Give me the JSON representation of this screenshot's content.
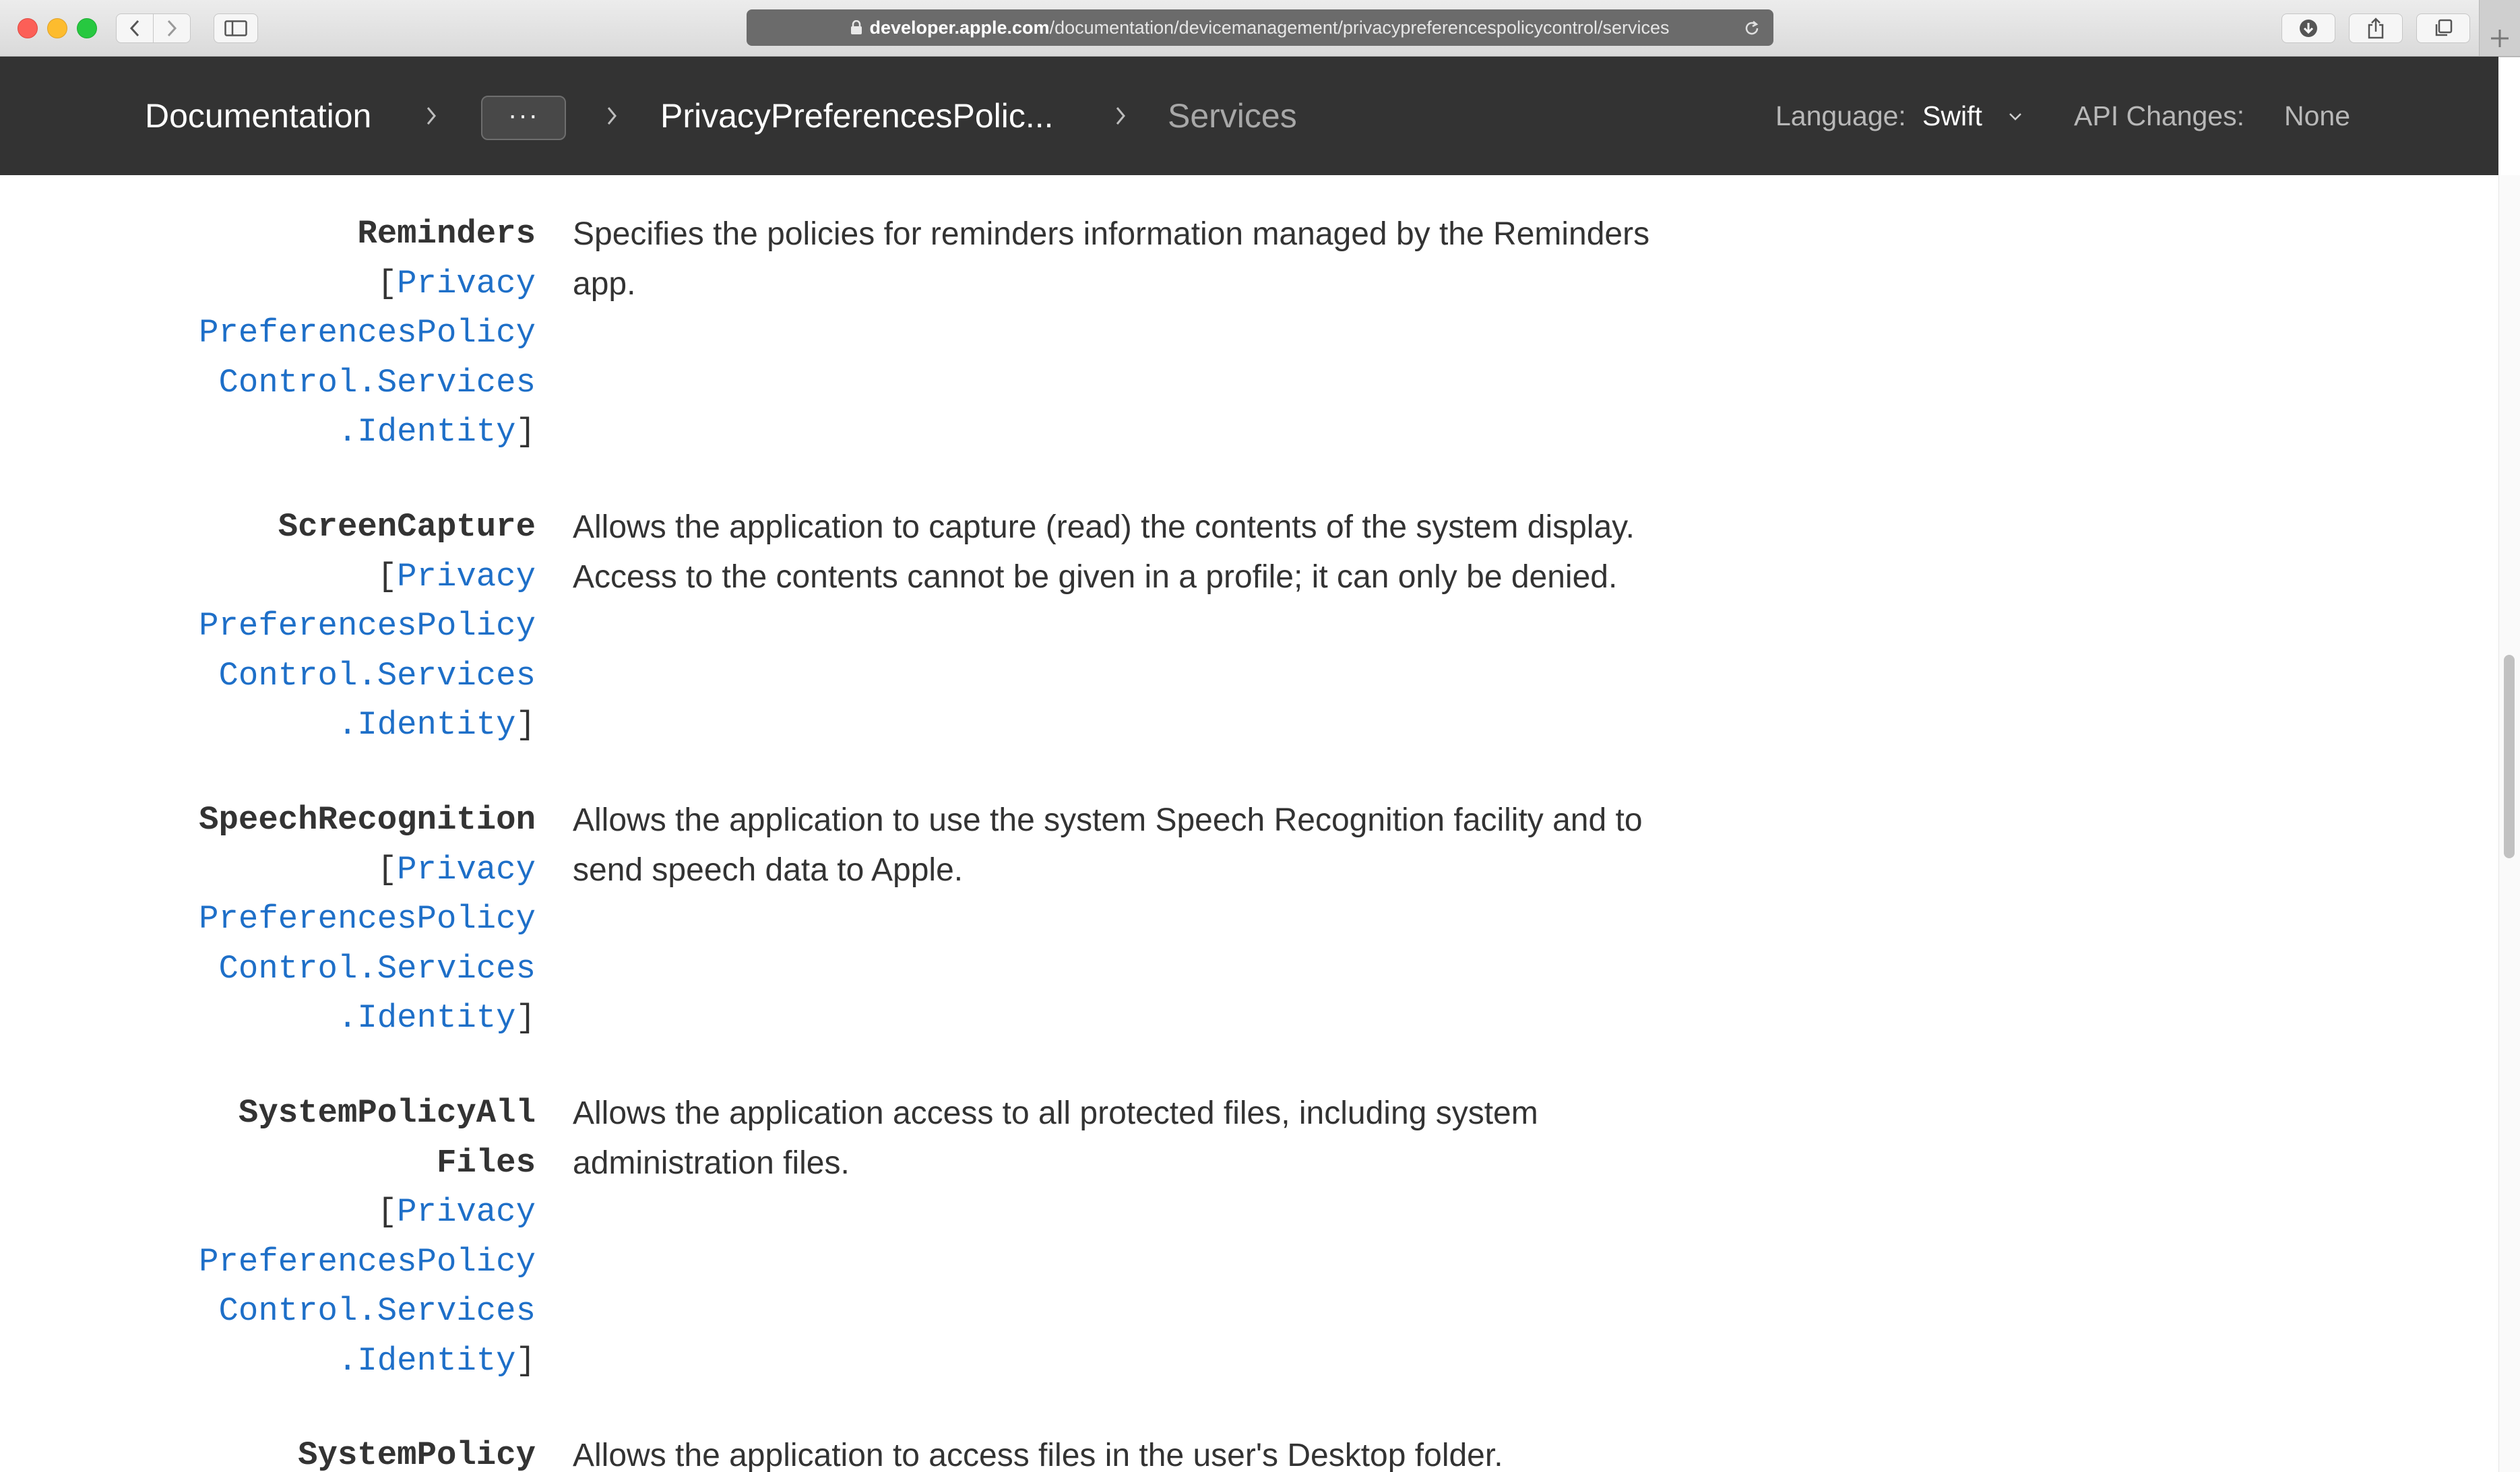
{
  "browser": {
    "url_domain": "developer.apple.com",
    "url_path": "/documentation/devicemanagement/privacypreferencespolicycontrol/services"
  },
  "nav": {
    "documentation": "Documentation",
    "ellipsis": "···",
    "class_crumb": "PrivacyPreferencesPolic...",
    "current_crumb": "Services",
    "language_label": "Language:",
    "language_value": "Swift",
    "api_changes_label": "API Changes:",
    "api_changes_value": "None"
  },
  "entries": [
    {
      "name_lines": [
        "Reminders"
      ],
      "type_lines": [
        "Privacy",
        "PreferencesPolicy",
        "Control.Services",
        ".Identity"
      ],
      "desc_lines": [
        "Specifies the policies for reminders information managed by the Reminders",
        "app."
      ]
    },
    {
      "name_lines": [
        "ScreenCapture"
      ],
      "type_lines": [
        "Privacy",
        "PreferencesPolicy",
        "Control.Services",
        ".Identity"
      ],
      "desc_lines": [
        "Allows the application to capture (read) the contents of the system display.",
        "Access to the contents cannot be given in a profile; it can only be denied."
      ]
    },
    {
      "name_lines": [
        "SpeechRecognition"
      ],
      "type_lines": [
        "Privacy",
        "PreferencesPolicy",
        "Control.Services",
        ".Identity"
      ],
      "desc_lines": [
        "Allows the application to use the system Speech Recognition facility and to",
        "send speech data to Apple."
      ]
    },
    {
      "name_lines": [
        "SystemPolicyAll",
        "Files"
      ],
      "type_lines": [
        "Privacy",
        "PreferencesPolicy",
        "Control.Services",
        ".Identity"
      ],
      "desc_lines": [
        "Allows the application access to all protected files, including system",
        "administration files."
      ]
    },
    {
      "name_lines": [
        "SystemPolicy"
      ],
      "type_lines": [],
      "desc_lines": [
        "Allows the application to access files in the user's Desktop folder."
      ]
    }
  ]
}
